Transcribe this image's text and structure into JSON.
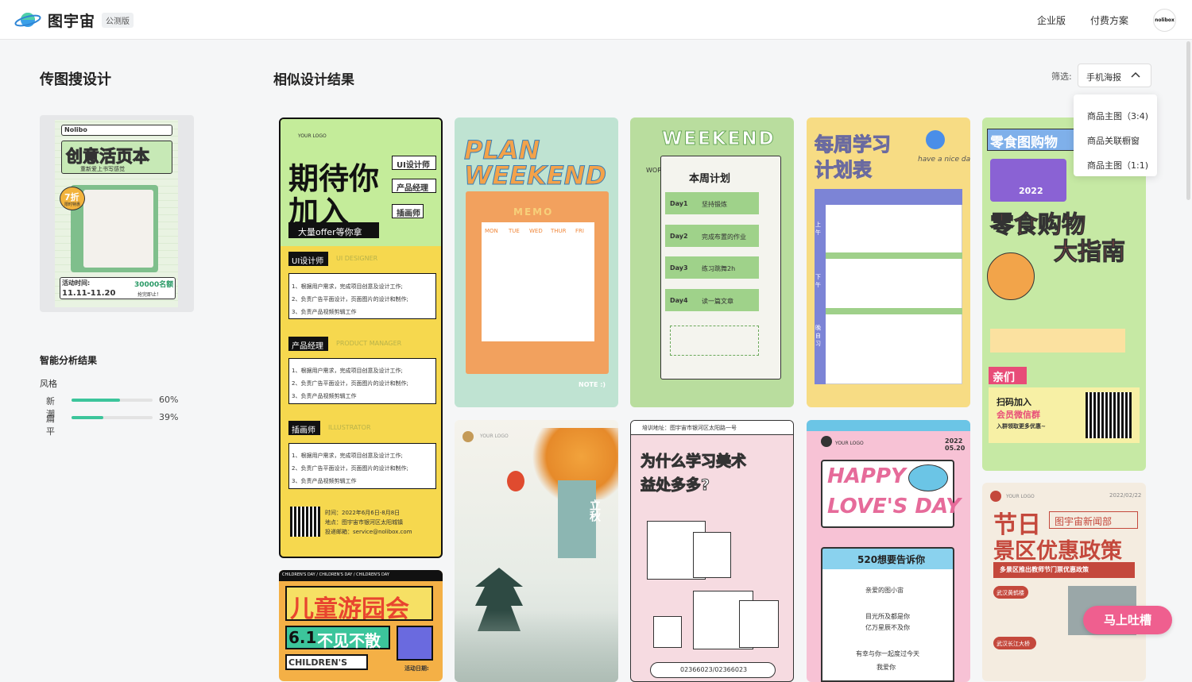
{
  "header": {
    "app_name": "图宇宙",
    "beta_badge": "公测版",
    "nav": [
      "企业版",
      "付费方案"
    ],
    "avatar_text": "nolibox"
  },
  "left_panel": {
    "title": "传图搜设计",
    "upload_preview": {
      "brand": "Nolibo",
      "headline": "创意活页本",
      "subline": "重新爱上书写感觉",
      "discount": "7折",
      "discount_note": "限时特惠",
      "activity_label": "活动时间:",
      "activity_dates": "11.11-11.20",
      "quota": "30000名额",
      "quota_note": "抢完即止！"
    },
    "analysis": {
      "title": "智能分析结果",
      "style_label": "风格",
      "bars": [
        {
          "name": "新潮",
          "value": 0.6,
          "text": "60%"
        },
        {
          "name": "扁平",
          "value": 0.39,
          "text": "39%"
        }
      ]
    }
  },
  "results": {
    "title": "相似设计结果",
    "filter_label": "筛选:",
    "filter_value": "手机海报",
    "filter_options": [
      "商品主图（3:4)",
      "商品关联橱窗",
      "商品主图（1:1)"
    ],
    "cards": {
      "recruit": {
        "logo": "YOUR LOGO",
        "headline_1": "期待你",
        "headline_2": "加入",
        "roles": [
          "UI设计师",
          "产品经理",
          "插画师"
        ],
        "offer": "大量offer等你拿",
        "sections": [
          {
            "title": "UI设计师",
            "en": "UI DESIGNER"
          },
          {
            "title": "产品经理",
            "en": "PRODUCT MANAGER"
          },
          {
            "title": "插画师",
            "en": "ILLUSTRATOR"
          }
        ],
        "duties": [
          "1、根据用户需求，完成项目创意及设计工作;",
          "2、负责广告平面设计，页面图片的设计和制作;",
          "3、负责产品视频剪辑工作"
        ],
        "time": "时间：2022年6月6日-8月8日",
        "place": "地点：图宇宙市银河区太阳城镇",
        "email": "投递邮箱：service@nolibox.com"
      },
      "weekend": {
        "title_1": "PLAN",
        "title_2": "WEEKEND",
        "memo": "MEMO",
        "days": [
          "MON",
          "TUE",
          "WED",
          "THUR",
          "FRI"
        ],
        "note": "NOTE :)"
      },
      "weekly": {
        "title": "WEEKEND",
        "work": "WORK",
        "subtitle": "本周计划",
        "items": [
          {
            "day": "Day1",
            "task": "坚持锻炼"
          },
          {
            "day": "Day2",
            "task": "完成布置的作业"
          },
          {
            "day": "Day3",
            "task": "练习跳舞2h"
          },
          {
            "day": "Day4",
            "task": "读一篇文章"
          }
        ]
      },
      "study": {
        "title_1": "每周学习",
        "title_2": "计划表",
        "script": "have a nice day",
        "rows": [
          "上午",
          "下午",
          "晚自习"
        ]
      },
      "snack": {
        "top": "零食图购物",
        "year": "2022",
        "headline_1": "零食购物",
        "headline_2": "大指南",
        "join": "亲们",
        "scan": "扫码加入",
        "group": "会员微信群",
        "more": "入群领取更多优惠~"
      },
      "kids": {
        "ribbon": "CHILDREN'S DAY / CHILDREN'S DAY / CHILDREN'S DAY",
        "headline": "儿童游园会",
        "date": "6.1",
        "tagline": "不见不散",
        "en": "CHILDREN'S",
        "tag": "活动日期:"
      },
      "autumn": {
        "logo": "YOUR LOGO",
        "term": "立秋"
      },
      "art": {
        "address": "培训地址：图宇宙市银河区太阳路一号",
        "q1": "为什么学习美术",
        "q2": "益处多多?",
        "phone": "02366023/02366023"
      },
      "love": {
        "logo": "YOUR LOGO",
        "date": "2022 05.20",
        "headline_1": "HAPPY",
        "headline_2": "LOVE'S DAY",
        "banner": "520想要告诉你",
        "lines": [
          "亲爱的图小宙",
          "目光所及都是你",
          "亿万星辰不及你",
          "有幸与你一起度过今天",
          "我爱你"
        ]
      },
      "news": {
        "logo": "YOUR LOGO",
        "date": "2022/02/22",
        "headline_1": "节日",
        "dept": "图宇宙新闻部",
        "headline_2": "景区优惠政策",
        "strip": "多景区推出教师节门票优惠政策",
        "tag1": "武汉黄鹤楼",
        "tag2": "武汉长江大桥"
      }
    }
  },
  "feedback_button": "马上吐槽",
  "colors": {
    "accent": "#3cc59b",
    "feedback": "#ef5f8f"
  }
}
